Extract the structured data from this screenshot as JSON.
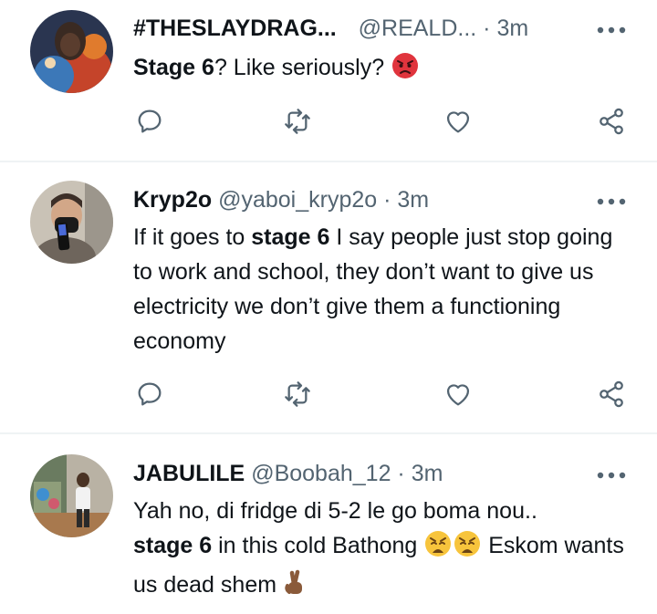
{
  "tweets": [
    {
      "display_name": "#THESLAYDRAG...",
      "handle": "@REALD...",
      "separator": " · ",
      "time": "3m",
      "body_parts": [
        {
          "text": "Stage 6",
          "bold": true
        },
        {
          "text": "? Like seriously?",
          "bold": false
        }
      ],
      "emojis": [
        "pouting-face-emoji"
      ]
    },
    {
      "display_name": "Kryp2o",
      "handle": "@yaboi_kryp2o",
      "separator": " · ",
      "time": "3m",
      "body_parts": [
        {
          "text": "If it goes to ",
          "bold": false
        },
        {
          "text": "stage 6",
          "bold": true
        },
        {
          "text": " I say people just stop going to work and school, they don’t want to give us electricity we don’t give them a functioning economy",
          "bold": false
        }
      ]
    },
    {
      "display_name": "JABULILE",
      "handle": "@Boobah_12",
      "separator": " · ",
      "time": "3m",
      "body_parts": [
        {
          "text": "Yah no, di fridge di 5-2 le go boma nou..",
          "bold": false
        },
        {
          "text": "stage 6",
          "bold": true
        },
        {
          "text": " in this cold Bathong ",
          "bold": false
        },
        {
          "text": " Eskom wants us dead shem ",
          "bold": false
        }
      ],
      "emojis": [
        "weary-face-emoji",
        "weary-face-emoji",
        "crossed-fingers-emoji"
      ]
    }
  ],
  "colors": {
    "text": "#0f1419",
    "secondary": "#536471",
    "separator": "#eff3f4",
    "accent": "#1d9bf0"
  }
}
